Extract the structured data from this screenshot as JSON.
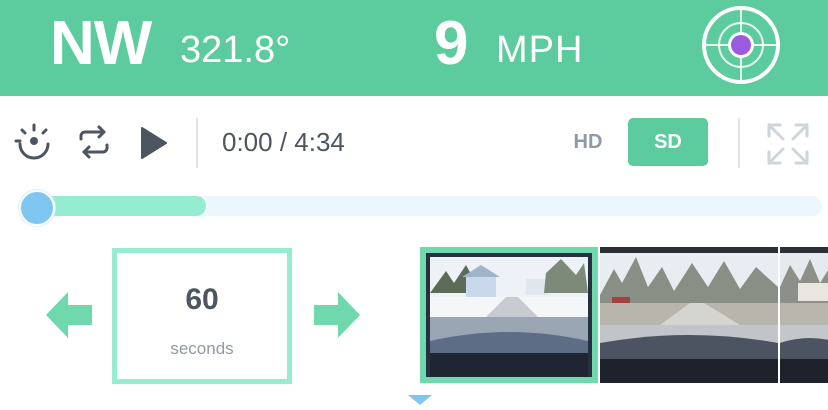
{
  "header": {
    "heading_dir": "NW",
    "heading_degrees": "321.8°",
    "speed_value": "9",
    "speed_unit": "MPH",
    "target_icon": "crosshair-target-icon"
  },
  "player": {
    "time": "0:00 / 4:34",
    "hd_label": "HD",
    "sd_label": "SD",
    "selected_quality": "SD",
    "progress_fraction": 0.23,
    "icons": [
      "ai-eye-icon",
      "repeat-icon",
      "play-icon",
      "fullscreen-icon"
    ]
  },
  "step": {
    "value": "60",
    "unit": "seconds"
  },
  "thumbnails": {
    "count": 3,
    "active_index": 0
  },
  "colors": {
    "brand_green": "#5ccb9d",
    "mint": "#96ecd1",
    "knob_blue": "#7fc6f3",
    "track_bg": "#ebf7fc",
    "target_dot": "#9b5be0",
    "text_dark": "#4d5560",
    "text_gray": "#8e9aa6"
  }
}
